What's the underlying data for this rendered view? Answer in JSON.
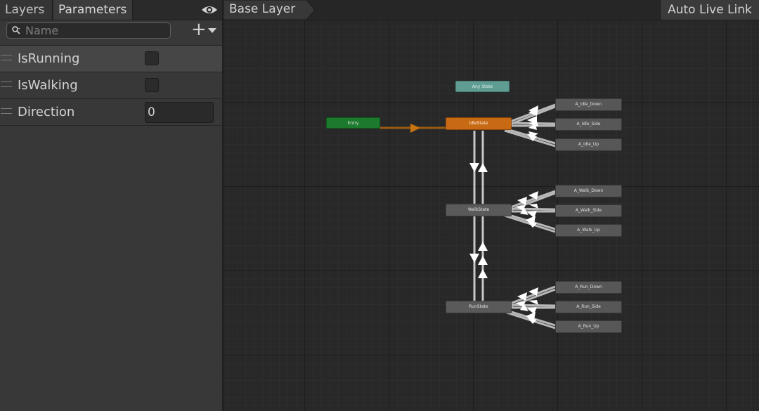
{
  "left_panel": {
    "tabs": {
      "layers": "Layers",
      "parameters": "Parameters"
    },
    "search": {
      "placeholder": "Name",
      "value": ""
    },
    "params": [
      {
        "name": "IsRunning",
        "type": "bool",
        "checked": false
      },
      {
        "name": "IsWalking",
        "type": "bool",
        "checked": false
      },
      {
        "name": "Direction",
        "type": "float",
        "value": "0"
      }
    ]
  },
  "graph": {
    "breadcrumb": "Base Layer",
    "auto_live_link": "Auto Live Link",
    "nodes": {
      "any_state": "Any State",
      "entry": "Entry",
      "idle": "IdleState",
      "walk": "WalkState",
      "run": "RunState",
      "idle_down": "A_Idle_Down",
      "idle_side": "A_Idle_Side",
      "idle_up": "A_Idle_Up",
      "walk_down": "A_Walk_Down",
      "walk_side": "A_Walk_Side",
      "walk_up": "A_Walk_Up",
      "run_down": "A_Run_Down",
      "run_side": "A_Run_Side",
      "run_up": "A_Run_Up"
    }
  },
  "colors": {
    "entry": "#1b7a2c",
    "any_state": "#5f9d93",
    "default_state": "#c86a14",
    "default_transition": "#b66a10",
    "transition": "#bdbdbd"
  },
  "icons": [
    "eye-icon",
    "search-icon",
    "plus-icon",
    "chevron-down-icon",
    "drag-handle-icon"
  ]
}
